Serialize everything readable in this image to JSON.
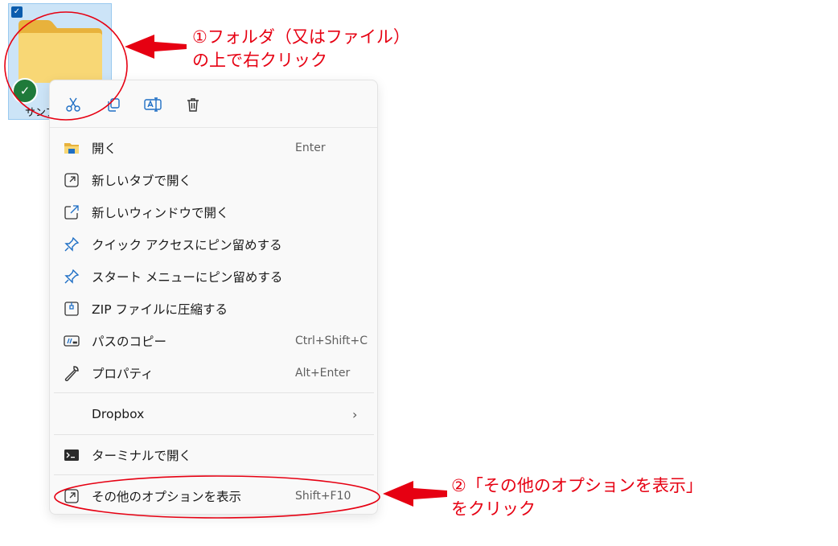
{
  "folder": {
    "label": "サンプ"
  },
  "menu": {
    "items": [
      {
        "label": "開く",
        "shortcut": "Enter"
      },
      {
        "label": "新しいタブで開く",
        "shortcut": ""
      },
      {
        "label": "新しいウィンドウで開く",
        "shortcut": ""
      },
      {
        "label": "クイック アクセスにピン留めする",
        "shortcut": ""
      },
      {
        "label": "スタート メニューにピン留めする",
        "shortcut": ""
      },
      {
        "label": "ZIP ファイルに圧縮する",
        "shortcut": ""
      },
      {
        "label": "パスのコピー",
        "shortcut": "Ctrl+Shift+C"
      },
      {
        "label": "プロパティ",
        "shortcut": "Alt+Enter"
      }
    ],
    "dropbox": {
      "label": "Dropbox"
    },
    "terminal": {
      "label": "ターミナルで開く"
    },
    "more": {
      "label": "その他のオプションを表示",
      "shortcut": "Shift+F10"
    }
  },
  "annotations": {
    "step1_line1": "①フォルダ（又はファイル）",
    "step1_line2": "の上で右クリック",
    "step2_line1": "②「その他のオプションを表示」",
    "step2_line2": "をクリック"
  },
  "colors": {
    "annotation_red": "#e60012",
    "icon_blue": "#1f6fc5",
    "selection_blue": "#cce4f7"
  }
}
